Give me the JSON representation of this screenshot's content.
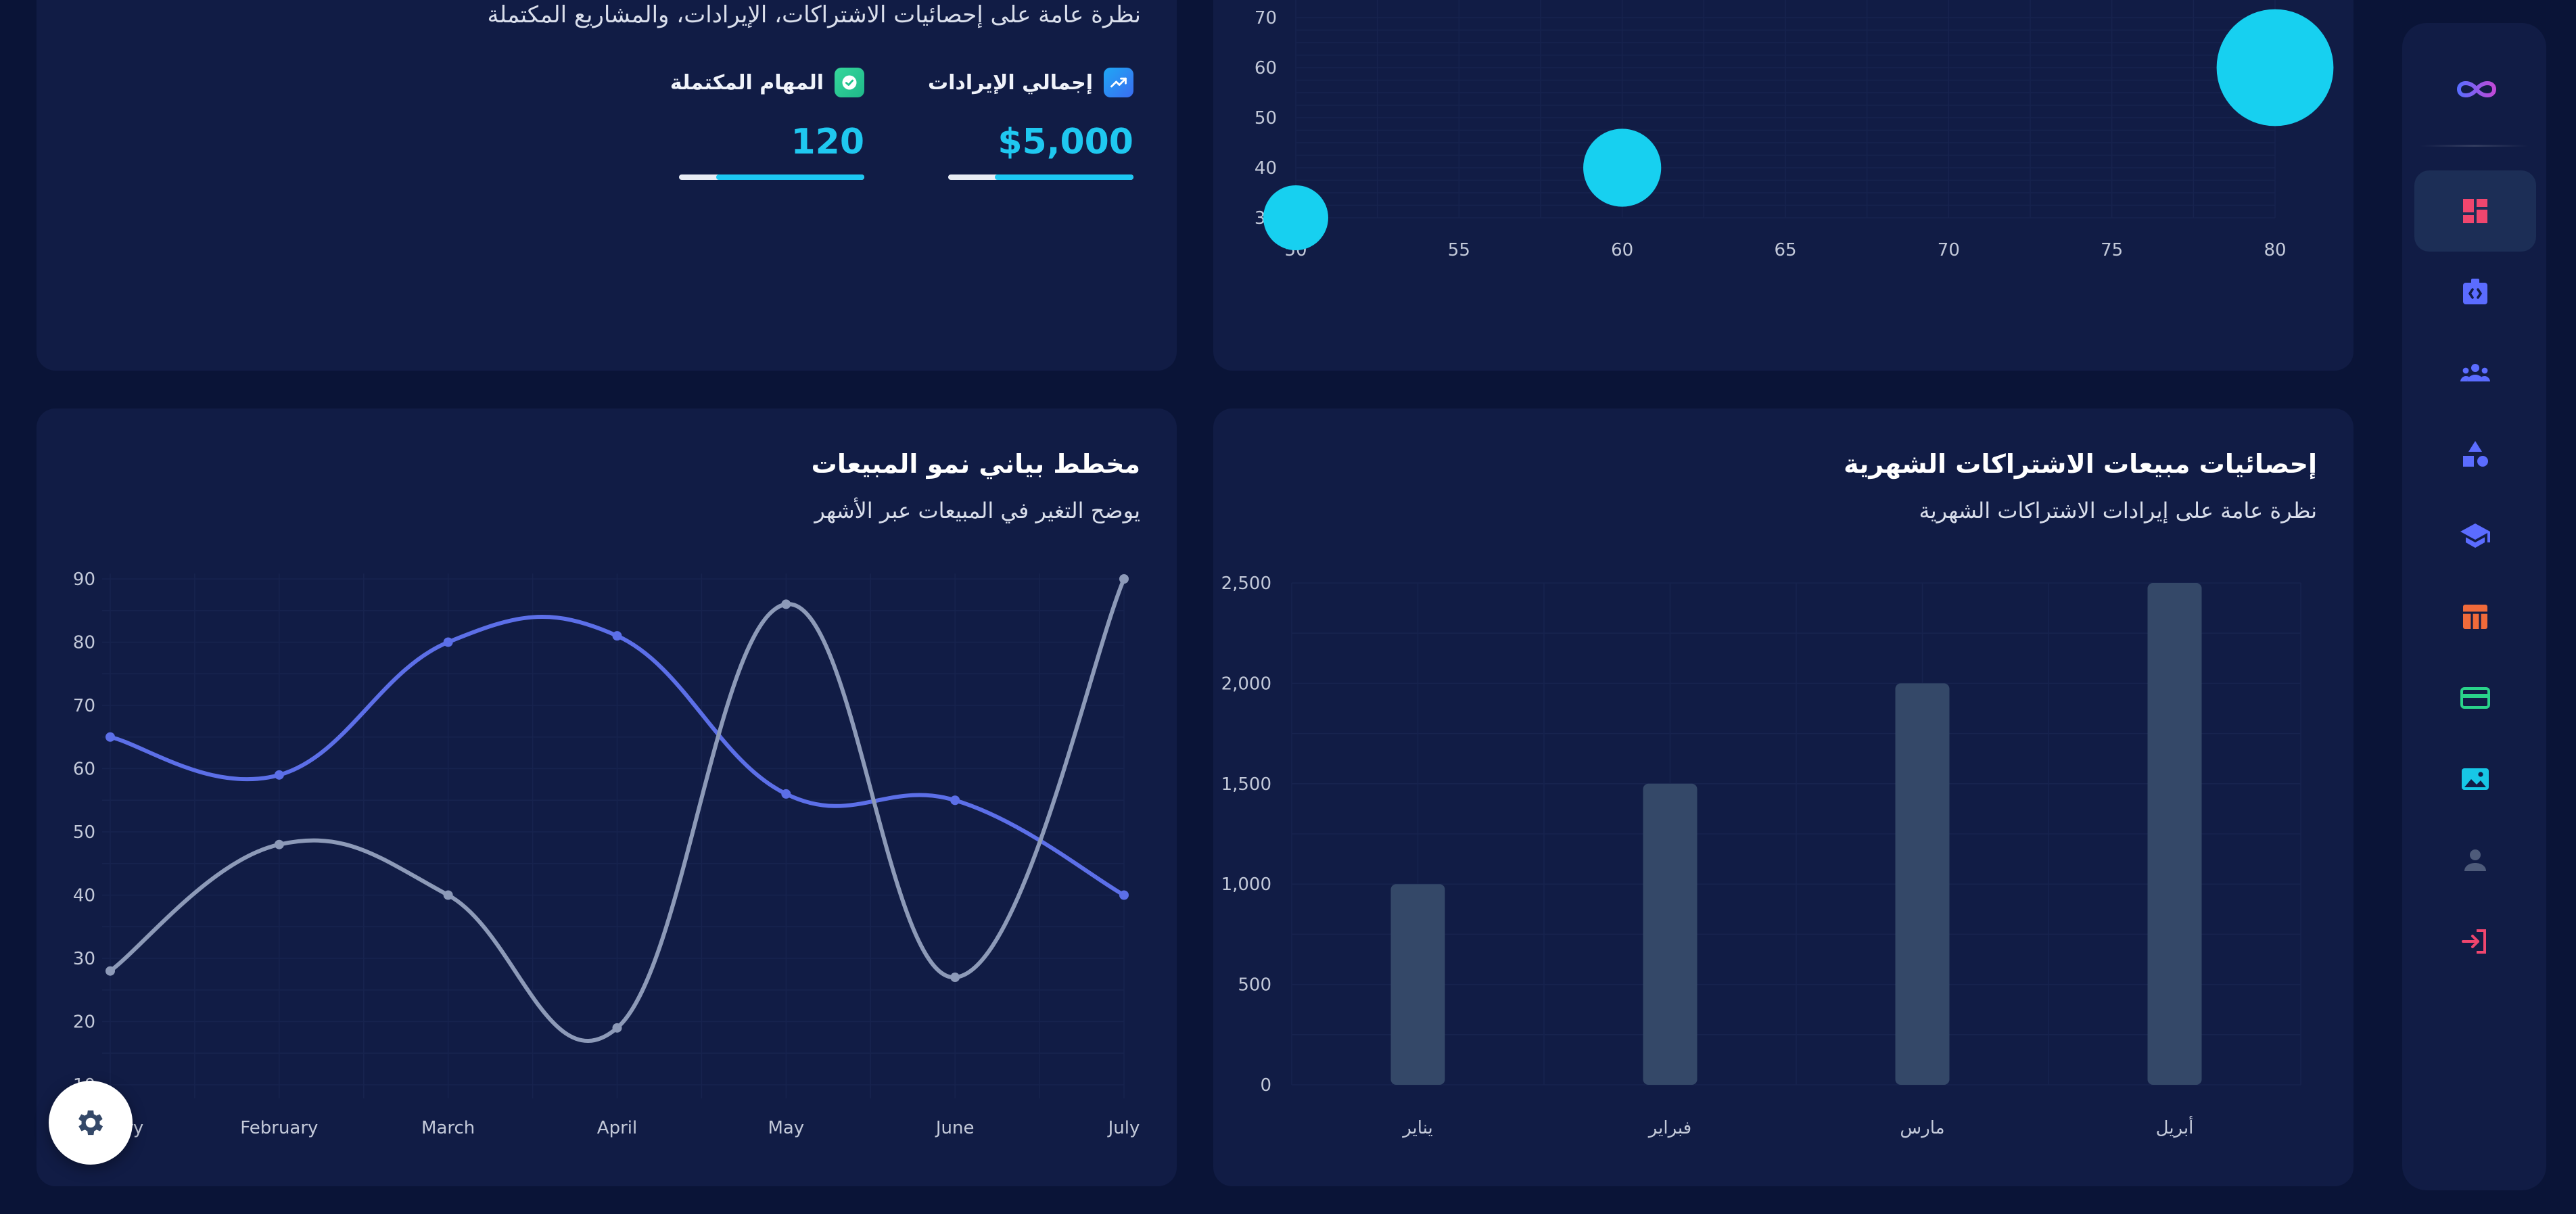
{
  "stats_card": {
    "subtitle": "نظرة عامة على إحصائيات الاشتراكات، الإيرادات، والمشاريع المكتملة",
    "stats": [
      {
        "label": "إجمالي الإيرادات",
        "value": "$5,000",
        "icon": "trending-up-icon",
        "progress": 0.75
      },
      {
        "label": "المهام المكتملة",
        "value": "120",
        "icon": "check-circle-icon",
        "progress": 0.8
      }
    ]
  },
  "sidebar": {
    "logo_icon": "infinity-logo-icon",
    "items": [
      {
        "icon": "dashboard-icon",
        "color": "#f0466e",
        "active": true
      },
      {
        "icon": "id-badge-icon",
        "color": "#5b6cff",
        "active": false
      },
      {
        "icon": "group-icon",
        "color": "#5b6cff",
        "active": false
      },
      {
        "icon": "shapes-icon",
        "color": "#5b6cff",
        "active": false
      },
      {
        "icon": "graduation-cap-icon",
        "color": "#5b6cff",
        "active": false
      },
      {
        "icon": "table-icon",
        "color": "#f06a3a",
        "active": false
      },
      {
        "icon": "credit-card-icon",
        "color": "#2ad38a",
        "active": false
      },
      {
        "icon": "image-icon",
        "color": "#17c7e6",
        "active": false
      },
      {
        "icon": "person-icon",
        "color": "#4e5b7a",
        "active": false
      },
      {
        "icon": "login-icon",
        "color": "#f0466e",
        "active": false
      }
    ]
  },
  "bubble_card": {
    "chart_data": {
      "type": "scatter",
      "title": "",
      "xlabel": "",
      "ylabel": "",
      "x_ticks": [
        50,
        55,
        60,
        65,
        70,
        75,
        80
      ],
      "y_ticks": [
        30,
        40,
        50,
        60,
        70
      ],
      "xlim": [
        50,
        80
      ],
      "ylim": [
        30,
        70
      ],
      "points": [
        {
          "x": 50,
          "y": 30,
          "r": 10
        },
        {
          "x": 60,
          "y": 40,
          "r": 12
        },
        {
          "x": 80,
          "y": 60,
          "r": 18
        }
      ],
      "color": "#17d0f0",
      "grid": true
    }
  },
  "line_card": {
    "title": "مخطط بياني نمو المبيعات",
    "subtitle": "يوضح التغير في المبيعات عبر الأشهر",
    "chart_data": {
      "type": "line",
      "categories": [
        "January",
        "February",
        "March",
        "April",
        "May",
        "June",
        "July"
      ],
      "y_ticks": [
        10,
        20,
        30,
        40,
        50,
        60,
        70,
        80,
        90
      ],
      "ylim": [
        10,
        90
      ],
      "series": [
        {
          "values": [
            65,
            59,
            80,
            81,
            56,
            55,
            40
          ],
          "color": "#5c6fe8"
        },
        {
          "values": [
            28,
            48,
            40,
            19,
            86,
            27,
            90
          ],
          "color": "#8d9ab8"
        }
      ],
      "grid": true
    }
  },
  "bar_card": {
    "title": "إحصائيات مبيعات الاشتراكات الشهرية",
    "subtitle": "نظرة عامة على إيرادات الاشتراكات الشهرية",
    "chart_data": {
      "type": "bar",
      "categories": [
        "يناير",
        "فبراير",
        "مارس",
        "أبريل"
      ],
      "values": [
        1000,
        1500,
        2000,
        2500
      ],
      "y_ticks": [
        "0",
        "500",
        "1,000",
        "1,500",
        "2,000",
        "2,500"
      ],
      "ylim": [
        0,
        2500
      ],
      "color": "#344868",
      "grid": true
    }
  },
  "fab": {
    "icon": "settings-gear-icon"
  }
}
